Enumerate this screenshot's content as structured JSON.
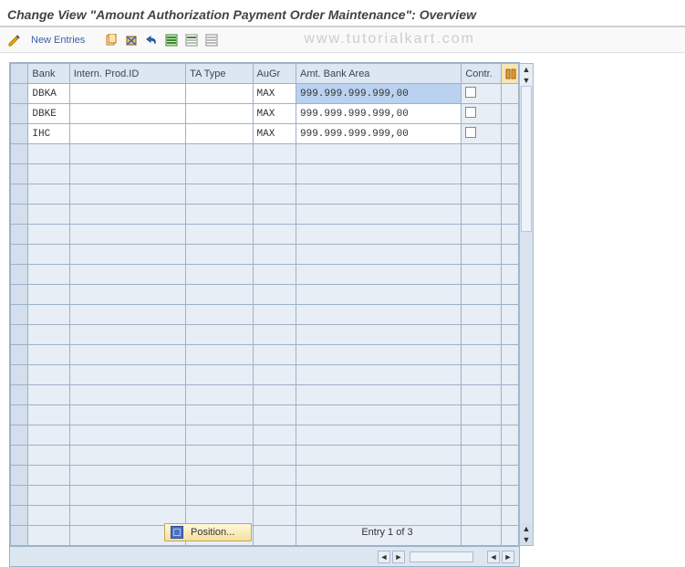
{
  "title": "Change View \"Amount Authorization Payment Order Maintenance\": Overview",
  "toolbar": {
    "new_entries_label": "New Entries"
  },
  "watermark": "www.tutorialkart.com",
  "columns": {
    "bank": "Bank",
    "prod": "Intern. Prod.ID",
    "tatype": "TA Type",
    "augr": "AuGr",
    "amt": "Amt. Bank Area",
    "contr": "Contr."
  },
  "rows": [
    {
      "bank": "DBKA",
      "prod": "",
      "tatype": "",
      "augr": "MAX",
      "amt": "999.999.999.999,00",
      "selected": true
    },
    {
      "bank": "DBKE",
      "prod": "",
      "tatype": "",
      "augr": "MAX",
      "amt": "999.999.999.999,00",
      "selected": false
    },
    {
      "bank": "IHC",
      "prod": "",
      "tatype": "",
      "augr": "MAX",
      "amt": "999.999.999.999,00",
      "selected": false
    }
  ],
  "empty_row_count": 20,
  "footer": {
    "position_label": "Position...",
    "entry_text": "Entry 1 of 3"
  }
}
